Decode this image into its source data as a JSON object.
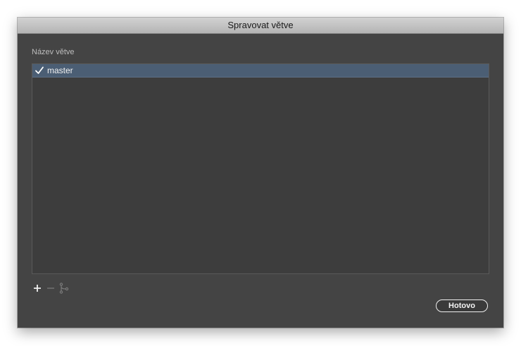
{
  "window": {
    "title": "Spravovat větve"
  },
  "branches": {
    "column_label": "Název větve",
    "items": [
      {
        "name": "master",
        "checked": true
      }
    ]
  },
  "toolbar": {
    "add_icon": "plus-icon",
    "remove_icon": "minus-icon",
    "branch_icon": "branch-icon"
  },
  "actions": {
    "done_label": "Hotovo"
  },
  "colors": {
    "dialog_bg": "#444444",
    "selection": "#4b5e74",
    "titlebar": "#c4c4c4"
  }
}
